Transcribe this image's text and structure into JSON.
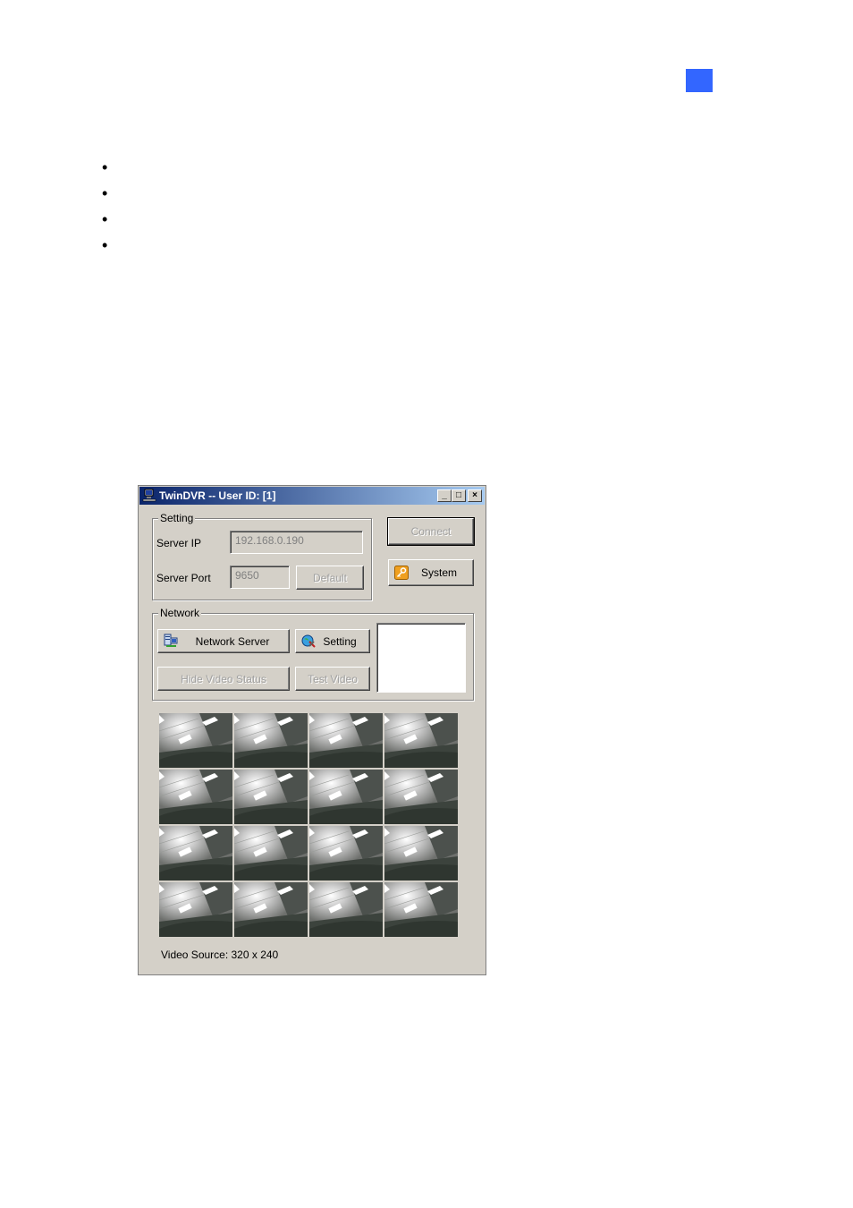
{
  "page": {
    "marker_color": "#3366ff",
    "bullet_count": 4
  },
  "window": {
    "title": "TwinDVR -- User ID: [1]",
    "title_icon": "computer-network-icon",
    "controls": {
      "minimize": "_",
      "maximize": "□",
      "close": "×"
    },
    "setting_group": {
      "label": "Setting",
      "server_ip_label": "Server IP",
      "server_ip_value": "192.168.0.190",
      "server_port_label": "Server Port",
      "server_port_value": "9650",
      "default_button": "Default"
    },
    "connect_button": "Connect",
    "system_button": "System",
    "system_icon": "key-icon",
    "network_group": {
      "label": "Network",
      "network_server_button": "Network Server",
      "network_server_icon": "server-icon",
      "setting_button": "Setting",
      "setting_icon": "globe-tools-icon",
      "hide_video_status_button": "Hide Video Status",
      "test_video_button": "Test Video"
    },
    "video_grid": {
      "rows": 4,
      "cols": 4,
      "camera_count": 16
    },
    "video_source": "Video Source: 320 x 240"
  }
}
